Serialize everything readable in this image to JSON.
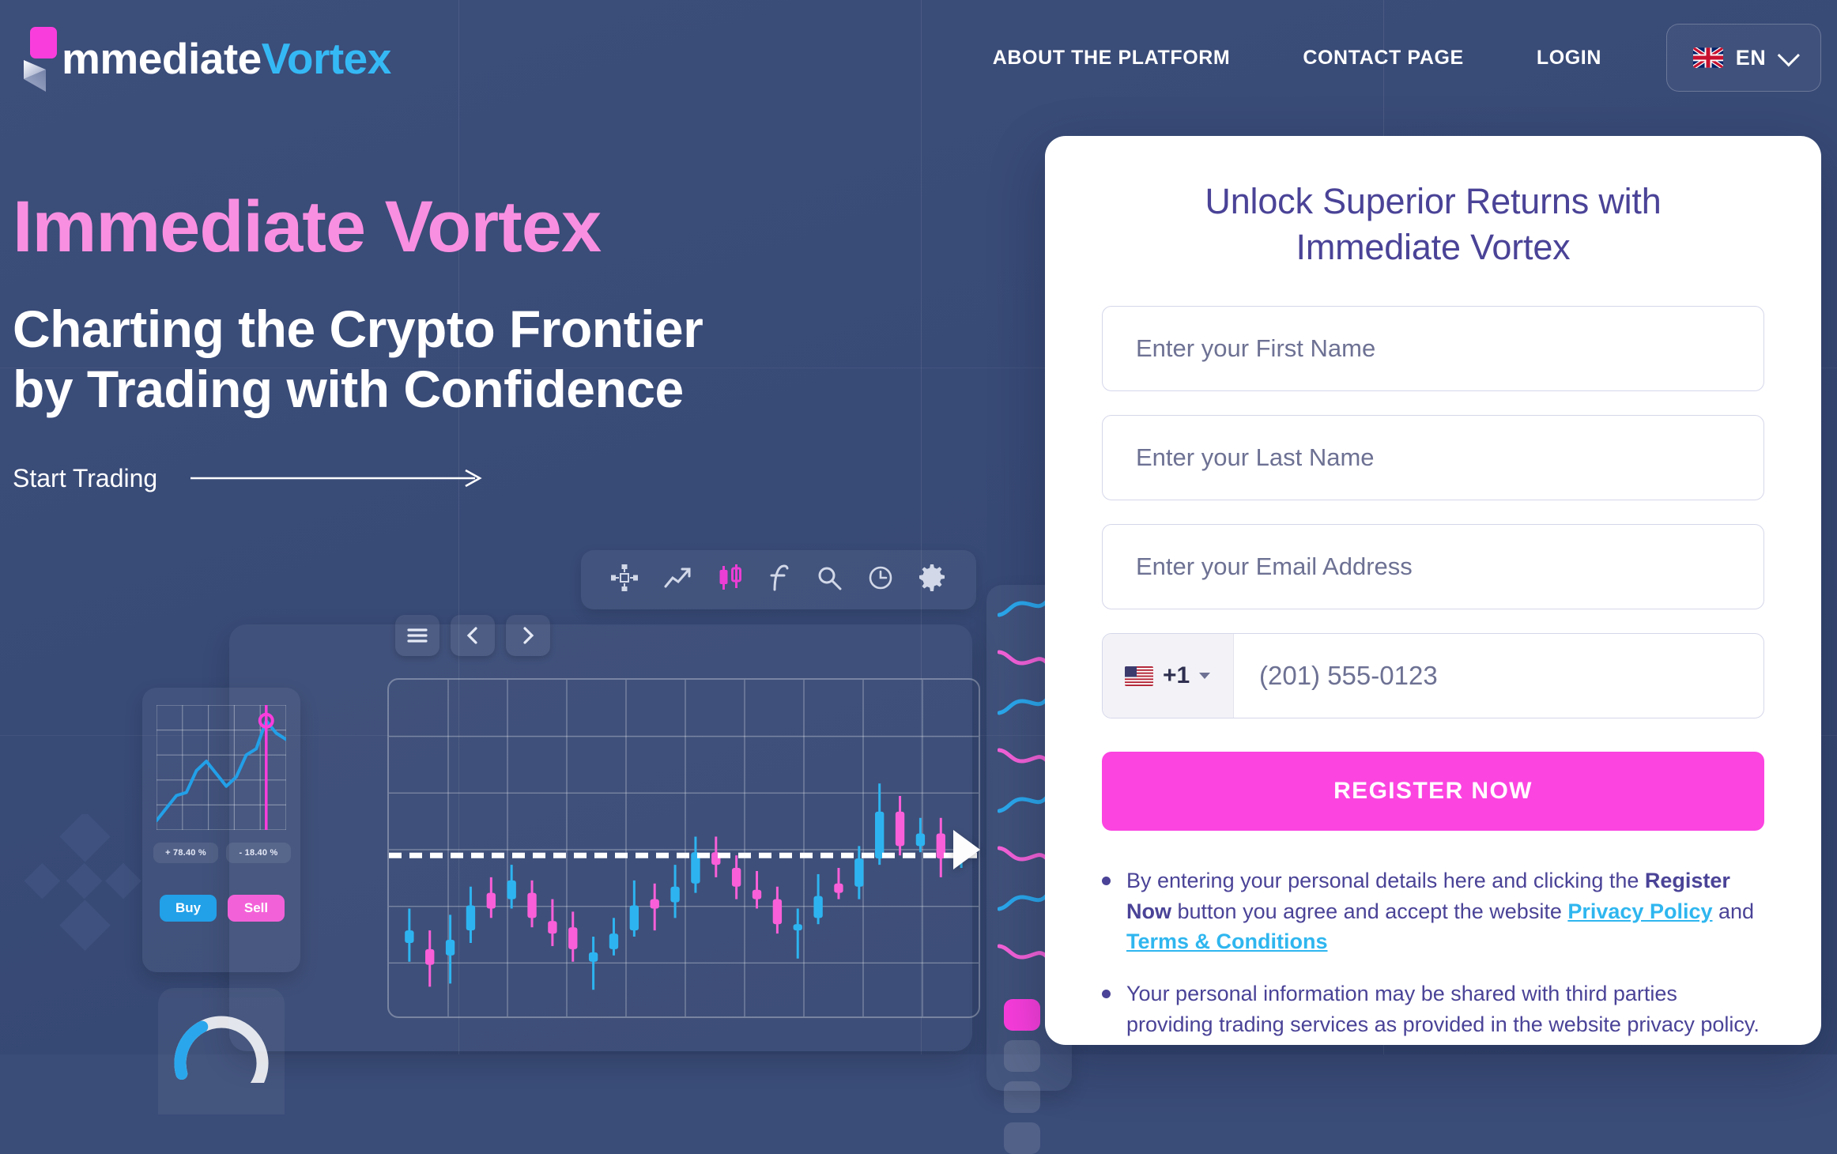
{
  "brand": {
    "name_part1": "mmediate",
    "name_part2": "Vortex",
    "accent_color": "#35b9f5",
    "pink": "#f93ddc"
  },
  "header": {
    "nav": [
      {
        "label": "ABOUT THE PLATFORM",
        "name": "nav-about-the-platform"
      },
      {
        "label": "CONTACT PAGE",
        "name": "nav-contact-page"
      },
      {
        "label": "LOGIN",
        "name": "nav-login"
      }
    ],
    "language": {
      "code": "EN",
      "flag": "uk-flag-icon"
    }
  },
  "hero": {
    "title": "Immediate Vortex",
    "subtitle_line1": "Charting the Crypto Frontier",
    "subtitle_line2": "by Trading with Confidence",
    "cta_label": "Start Trading",
    "title_color": "#f98fe0"
  },
  "illustration": {
    "toolbar_icons": [
      "crosshair-icon",
      "trend-line-icon",
      "candlestick-icon",
      "function-icon",
      "magnifier-icon",
      "clock-icon",
      "gear-icon"
    ],
    "panel_controls": [
      "hamburger-icon",
      "chevron-left-icon",
      "chevron-right-icon"
    ],
    "stats": [
      {
        "label": "+ 78.40 %",
        "kind": "gain"
      },
      {
        "label": "- 18.40 %",
        "kind": "loss"
      }
    ],
    "trade_buttons": [
      {
        "label": "Buy",
        "color": "#22a0e8"
      },
      {
        "label": "Sell",
        "color": "#f361d8"
      }
    ]
  },
  "chart_data": {
    "type": "candlestick",
    "title": "",
    "xlabel": "",
    "ylabel": "",
    "grid": true,
    "legend": false,
    "up_color": "#2db4f0",
    "down_color": "#f95fd8",
    "price_line": {
      "value": 50,
      "style": "dashed",
      "color": "#ffffff"
    },
    "ylim": [
      0,
      100
    ],
    "candles": [
      {
        "o": 22,
        "c": 26,
        "h": 33,
        "l": 16,
        "dir": "up"
      },
      {
        "o": 20,
        "c": 15,
        "h": 26,
        "l": 8,
        "dir": "down"
      },
      {
        "o": 18,
        "c": 23,
        "h": 31,
        "l": 9,
        "dir": "up"
      },
      {
        "o": 26,
        "c": 34,
        "h": 40,
        "l": 22,
        "dir": "up"
      },
      {
        "o": 33,
        "c": 38,
        "h": 43,
        "l": 30,
        "dir": "down"
      },
      {
        "o": 36,
        "c": 42,
        "h": 47,
        "l": 33,
        "dir": "up"
      },
      {
        "o": 38,
        "c": 30,
        "h": 42,
        "l": 27,
        "dir": "down"
      },
      {
        "o": 29,
        "c": 25,
        "h": 36,
        "l": 21,
        "dir": "down"
      },
      {
        "o": 27,
        "c": 20,
        "h": 32,
        "l": 16,
        "dir": "down"
      },
      {
        "o": 19,
        "c": 16,
        "h": 24,
        "l": 7,
        "dir": "up"
      },
      {
        "o": 20,
        "c": 25,
        "h": 30,
        "l": 18,
        "dir": "up"
      },
      {
        "o": 26,
        "c": 34,
        "h": 42,
        "l": 24,
        "dir": "up"
      },
      {
        "o": 33,
        "c": 36,
        "h": 41,
        "l": 26,
        "dir": "down"
      },
      {
        "o": 35,
        "c": 40,
        "h": 47,
        "l": 30,
        "dir": "up"
      },
      {
        "o": 41,
        "c": 51,
        "h": 56,
        "l": 38,
        "dir": "up"
      },
      {
        "o": 51,
        "c": 47,
        "h": 56,
        "l": 43,
        "dir": "down"
      },
      {
        "o": 46,
        "c": 40,
        "h": 50,
        "l": 36,
        "dir": "down"
      },
      {
        "o": 39,
        "c": 36,
        "h": 45,
        "l": 33,
        "dir": "down"
      },
      {
        "o": 36,
        "c": 28,
        "h": 40,
        "l": 25,
        "dir": "down"
      },
      {
        "o": 28,
        "c": 26,
        "h": 33,
        "l": 17,
        "dir": "up"
      },
      {
        "o": 30,
        "c": 37,
        "h": 44,
        "l": 28,
        "dir": "up"
      },
      {
        "o": 38,
        "c": 41,
        "h": 46,
        "l": 36,
        "dir": "down"
      },
      {
        "o": 40,
        "c": 49,
        "h": 53,
        "l": 36,
        "dir": "up"
      },
      {
        "o": 49,
        "c": 64,
        "h": 73,
        "l": 47,
        "dir": "up"
      },
      {
        "o": 64,
        "c": 53,
        "h": 69,
        "l": 50,
        "dir": "down"
      },
      {
        "o": 53,
        "c": 57,
        "h": 62,
        "l": 51,
        "dir": "up"
      },
      {
        "o": 57,
        "c": 49,
        "h": 62,
        "l": 43,
        "dir": "down"
      },
      {
        "o": 49,
        "c": 51,
        "h": 55,
        "l": 46,
        "dir": "up"
      }
    ],
    "mini_chart": {
      "type": "line",
      "color": "#22a0e8",
      "marker_color": "#f93ddc",
      "points": [
        6,
        14,
        22,
        24,
        38,
        44,
        36,
        28,
        34,
        48,
        52,
        70,
        62,
        58
      ]
    }
  },
  "form": {
    "title_line1": "Unlock Superior Returns with",
    "title_line2": "Immediate Vortex",
    "title_color": "#4a4397",
    "fields": [
      {
        "name": "first-name-field",
        "placeholder": "Enter your First Name",
        "value": ""
      },
      {
        "name": "last-name-field",
        "placeholder": "Enter your Last Name",
        "value": ""
      },
      {
        "name": "email-field",
        "placeholder": "Enter your Email Address",
        "value": ""
      }
    ],
    "phone": {
      "country_flag": "us-flag-icon",
      "country_code": "+1",
      "placeholder": "(201) 555-0123",
      "value": ""
    },
    "submit_label": "REGISTER NOW",
    "submit_color": "#fb44e0",
    "disclaimer": [
      {
        "prefix": "By entering your personal details here and clicking the ",
        "bold1": "Register Now",
        "mid": " button you agree and accept the website ",
        "link1": "Privacy Policy",
        "join": " and ",
        "link2": "Terms & Conditions",
        "suffix": ""
      },
      {
        "text": "Your personal information may be shared with third parties providing trading services as provided in the website privacy policy."
      }
    ],
    "link_color": "#2fb6ef"
  }
}
